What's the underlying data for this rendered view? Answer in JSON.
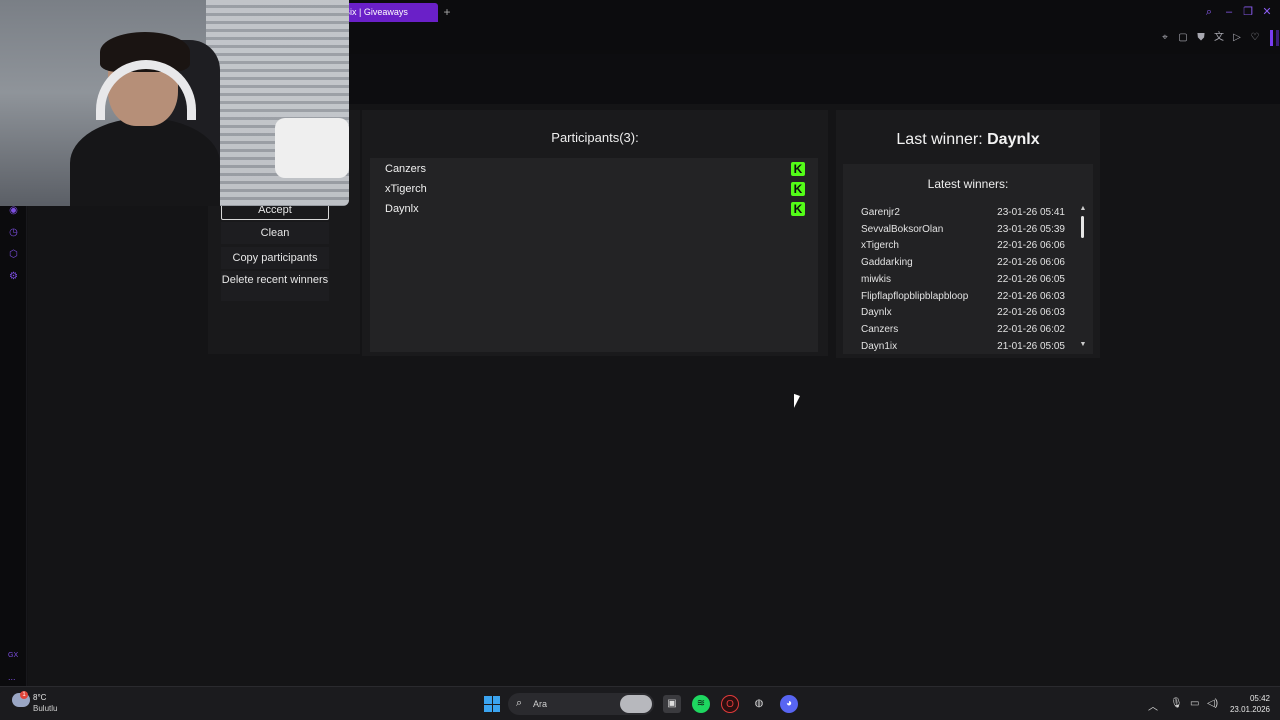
{
  "browser": {
    "tab_title": "Bix | Giveaways",
    "new_tab": "+"
  },
  "giveaway": {
    "buttons": {
      "accept": "Accept",
      "clean": "Clean",
      "copy": "Copy participants",
      "delete": "Delete recent winners"
    },
    "participants_title": "Participants(3):",
    "participants": [
      "Canzers",
      "xTigerch",
      "Daynlx"
    ],
    "platform_icon": "kick-icon",
    "last_winner_prefix": "Last winner: ",
    "last_winner": "Daynlx",
    "latest_winners_title": "Latest winners:",
    "latest_winners": [
      {
        "name": "Garenjr2",
        "date": "23-01-26 05:41"
      },
      {
        "name": "SevvalBoksorOlan",
        "date": "23-01-26 05:39"
      },
      {
        "name": "xTigerch",
        "date": "22-01-26 06:06"
      },
      {
        "name": "Gaddarking",
        "date": "22-01-26 06:06"
      },
      {
        "name": "miwkis",
        "date": "22-01-26 06:05"
      },
      {
        "name": "Flipflapflopblipblapbloop",
        "date": "22-01-26 06:03"
      },
      {
        "name": "Daynlx",
        "date": "22-01-26 06:03"
      },
      {
        "name": "Canzers",
        "date": "22-01-26 06:02"
      },
      {
        "name": "Dayn1ix",
        "date": "21-01-26 05:05"
      }
    ]
  },
  "taskbar": {
    "temperature": "8°C",
    "condition": "Bulutlu",
    "weather_badge": "1",
    "search_placeholder": "Ara",
    "time": "05:42",
    "date": "23.01.2026"
  },
  "sidebar": {
    "gx_label": "GX",
    "more": "..."
  },
  "colors": {
    "accent": "#7a3df0",
    "kick": "#53fc18",
    "tab": "#6a20c8"
  }
}
